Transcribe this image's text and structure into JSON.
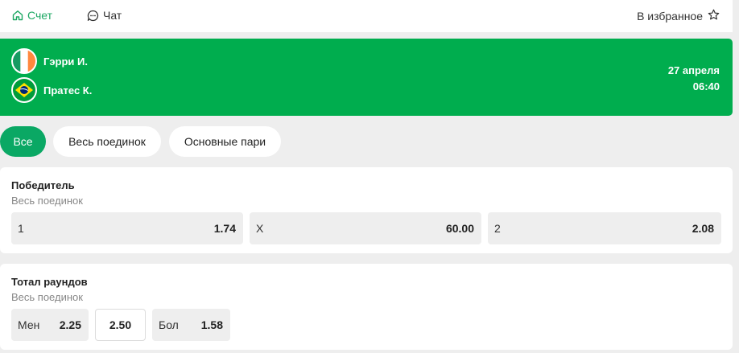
{
  "nav": {
    "tabs": [
      {
        "label": "Счет",
        "icon": "home-icon",
        "active": true
      },
      {
        "label": "Чат",
        "icon": "chat-icon",
        "active": false
      }
    ],
    "favorite_label": "В избранное",
    "favorite_icon": "star-icon"
  },
  "match": {
    "team1": {
      "name": "Гэрри И.",
      "flag": "ireland-flag-icon"
    },
    "team2": {
      "name": "Пратес К.",
      "flag": "brazil-flag-icon"
    },
    "date": "27 апреля",
    "time": "06:40"
  },
  "filters": [
    {
      "label": "Все",
      "active": true
    },
    {
      "label": "Весь поединок",
      "active": false
    },
    {
      "label": "Основные пари",
      "active": false
    }
  ],
  "markets": [
    {
      "title": "Победитель",
      "subtitle": "Весь поединок",
      "outcomes": [
        {
          "label": "1",
          "odds": "1.74"
        },
        {
          "label": "X",
          "odds": "60.00"
        },
        {
          "label": "2",
          "odds": "2.08"
        }
      ]
    },
    {
      "title": "Тотал раундов",
      "subtitle": "Весь поединок",
      "outcomes": [
        {
          "label": "Мен",
          "odds": "2.25"
        },
        {
          "label": "",
          "odds": "2.50"
        },
        {
          "label": "Бол",
          "odds": "1.58"
        }
      ]
    }
  ],
  "colors": {
    "accent": "#1ea864",
    "banner": "#00ad4e",
    "chip_active": "#0aa864",
    "background": "#eeeeee"
  }
}
